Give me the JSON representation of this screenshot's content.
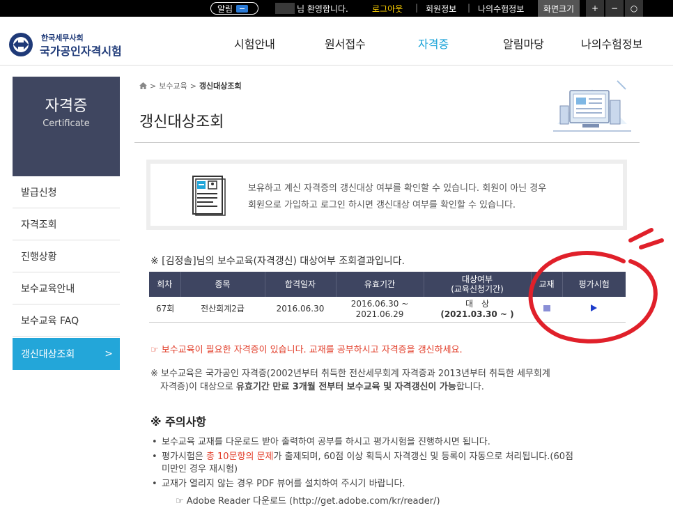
{
  "topbar": {
    "alert_label": "알림",
    "welcome": "님 환영합니다.",
    "logout": "로그아웃",
    "member_info": "회원정보",
    "my_exam_info": "나의수험정보",
    "font_size_label": "화면크기",
    "font_plus": "+",
    "font_minus": "−",
    "font_reset": "○",
    "separator": "|"
  },
  "header": {
    "logo_sub": "한국세무사회",
    "logo_main": "국가공인자격시험",
    "nav": [
      "시험안내",
      "원서접수",
      "자격증",
      "알림마당",
      "나의수험정보"
    ],
    "active_nav": "자격증",
    "accent_color": "#1aa3d8"
  },
  "sidebar": {
    "title": "자격증",
    "subtitle": "Certificate",
    "items": [
      {
        "label": "발급신청"
      },
      {
        "label": "자격조회"
      },
      {
        "label": "진행상황"
      },
      {
        "label": "보수교육안내"
      },
      {
        "label": "보수교육 FAQ"
      },
      {
        "label": "갱신대상조회",
        "arrow": ">"
      }
    ]
  },
  "breadcrumb": {
    "home_icon": "home-icon",
    "sep": ">",
    "parent": "보수교육",
    "current": "갱신대상조회"
  },
  "page": {
    "title": "갱신대상조회",
    "info_line1": "보유하고 계신 자격증의 갱신대상 여부를 확인할 수 있습니다. 회원이 아닌 경우",
    "info_line2": "회원으로 가입하고 로그인 하시면 갱신대상 여부를 확인할 수 있습니다."
  },
  "result": {
    "title": "※ [김정솔]님의 보수교육(자격갱신) 대상여부 조회결과입니다.",
    "headers": {
      "round": "회차",
      "type": "종목",
      "pass_date": "합격일자",
      "valid_period": "유효기간",
      "target_l1": "대상여부",
      "target_l2": "(교육신청기간)",
      "textbook": "교재",
      "eval": "평가시험"
    },
    "rows": [
      {
        "round": "67회",
        "type": "전산회계2급",
        "pass_date": "2016.06.30",
        "valid_l1": "2016.06.30 ~",
        "valid_l2": "2021.06.29",
        "target_l1": "대　상",
        "target_l2": "(2021.03.30 ~ )"
      }
    ]
  },
  "notices": {
    "red": "☞ 보수교육이 필요한 자격증이 있습니다. 교재를 공부하시고 자격증을 갱신하세요.",
    "note_l1": "※ 보수교육은 국가공인 자격증(2002년부터 취득한 전산세무회계 자격증과 2013년부터 취득한 세무회계",
    "note_l2_a": "자격증)이 대상으로 ",
    "note_l2_b": "유효기간 만료 3개월 전부터 보수교육 및 자격갱신이 가능",
    "note_l2_c": "합니다.",
    "caution_title": "※ 주의사항",
    "c1": "보수교육 교재를 다운로드 받아 출력하여 공부를 하시고 평가시험을 진행하시면 됩니다.",
    "c2_a": "평가시험은 ",
    "c2_b": "총 10문항의 문제",
    "c2_c": "가 출제되며, 60점 이상 획득시 자격갱신 및 등록이 자동으로 처리됩니다.(60점",
    "c2_d": "미만인 경우 재시험)",
    "c3": "교재가 열리지 않는 경우 PDF 뷰어를 설치하여 주시기 바랍니다.",
    "adobe": "☞ Adobe Reader 다운로드 (http://get.adobe.com/kr/reader/)"
  }
}
